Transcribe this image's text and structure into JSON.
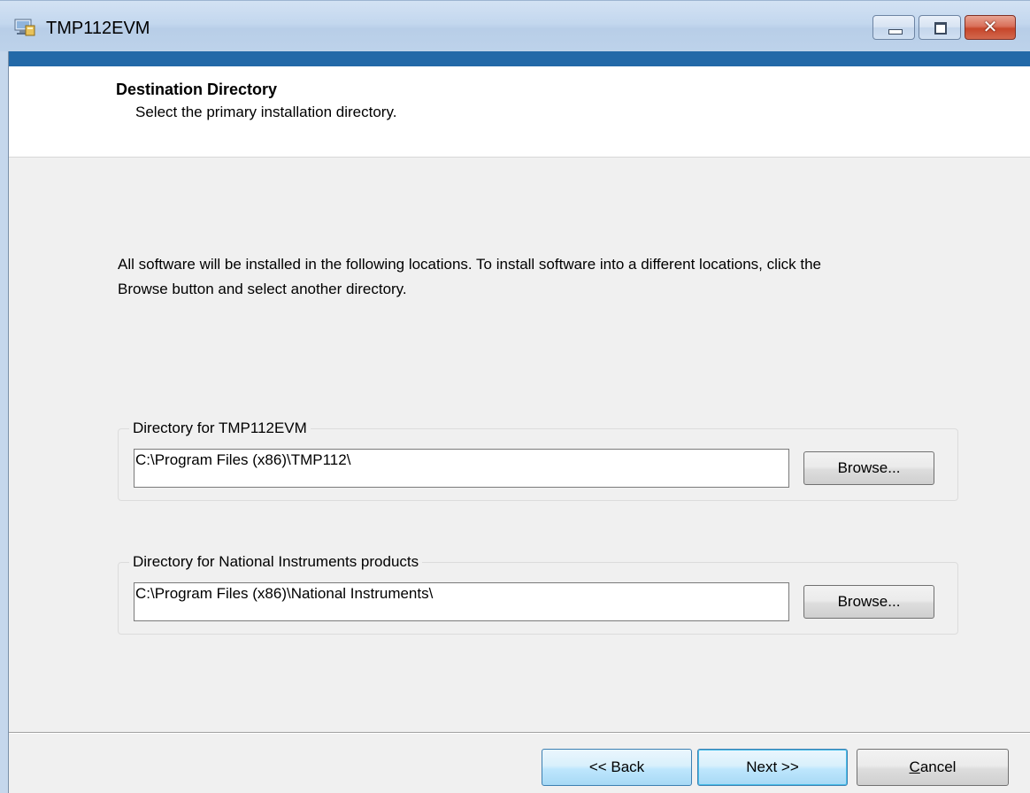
{
  "window": {
    "title": "TMP112EVM",
    "close_glyph": "✕"
  },
  "header": {
    "title": "Destination Directory",
    "subtitle": "Select the primary installation directory."
  },
  "description": "All software will be installed in the following locations. To install software into a different locations, click the Browse button and select another directory.",
  "groups": [
    {
      "legend": "Directory for TMP112EVM",
      "path": "C:\\Program Files (x86)\\TMP112\\",
      "browse_label": "Browse..."
    },
    {
      "legend": "Directory for National Instruments products",
      "path": "C:\\Program Files (x86)\\National Instruments\\",
      "browse_label": "Browse..."
    }
  ],
  "footer": {
    "back_label": "<< Back",
    "next_label": "Next >>",
    "cancel_label_first": "C",
    "cancel_label_rest": "ancel"
  },
  "colors": {
    "accent": "#2369a8",
    "close_button": "#c7462a"
  },
  "icons": {
    "app": "installer-icon",
    "minimize": "minimize-icon",
    "maximize": "maximize-icon",
    "close": "close-icon"
  }
}
